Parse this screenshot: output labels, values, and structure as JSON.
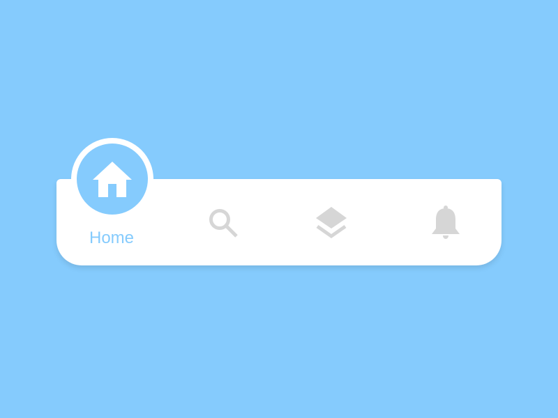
{
  "colors": {
    "background": "#85cbfd",
    "accent": "#85cbfd",
    "inactive_icon": "#d6d6d6",
    "bar": "#ffffff"
  },
  "nav": {
    "items": [
      {
        "label": "Home",
        "icon": "home-icon",
        "active": true
      },
      {
        "icon": "search-icon",
        "active": false
      },
      {
        "icon": "layers-icon",
        "active": false
      },
      {
        "icon": "bell-icon",
        "active": false
      }
    ]
  }
}
